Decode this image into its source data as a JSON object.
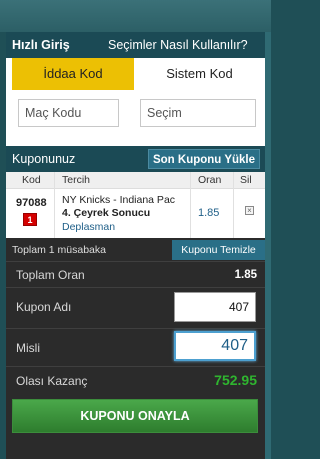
{
  "quick_entry": {
    "title": "Hızlı Giriş",
    "help_link": "Seçimler Nasıl Kullanılır?",
    "tabs": [
      {
        "label": "İddaa Kod",
        "active": true
      },
      {
        "label": "Sistem Kod",
        "active": false
      }
    ],
    "match_code_placeholder": "Maç Kodu",
    "selection_placeholder": "Seçim"
  },
  "coupon": {
    "title": "Kuponunuz",
    "load_last_button": "Son Kuponu Yükle",
    "columns": [
      "Kod",
      "Tercih",
      "Oran",
      "Sil"
    ],
    "rows": [
      {
        "code": "97088",
        "min_bet_badge": "1",
        "match": "NY Knicks - Indiana Pac",
        "bet_type": "4. Çeyrek Sonucu",
        "pick": "Deplasman",
        "odds": "1.85"
      }
    ],
    "summary_text": "Toplam 1 müsabaka",
    "clear_button": "Kuponu Temizle",
    "total_odds_label": "Toplam Oran",
    "total_odds_value": "1.85",
    "coupon_name_label": "Kupon Adı",
    "coupon_name_value": "407",
    "multiplier_label": "Misli",
    "multiplier_value": "407",
    "potential_win_label": "Olası Kazanç",
    "potential_win_value": "752.95",
    "confirm_button": "KUPONU ONAYLA"
  },
  "colors": {
    "header_bg": "#1b4a55",
    "active_tab": "#ecc004",
    "button_blue": "#2a6f87",
    "confirm_green": "#2e7d2e",
    "win_green": "#2fb52f"
  }
}
